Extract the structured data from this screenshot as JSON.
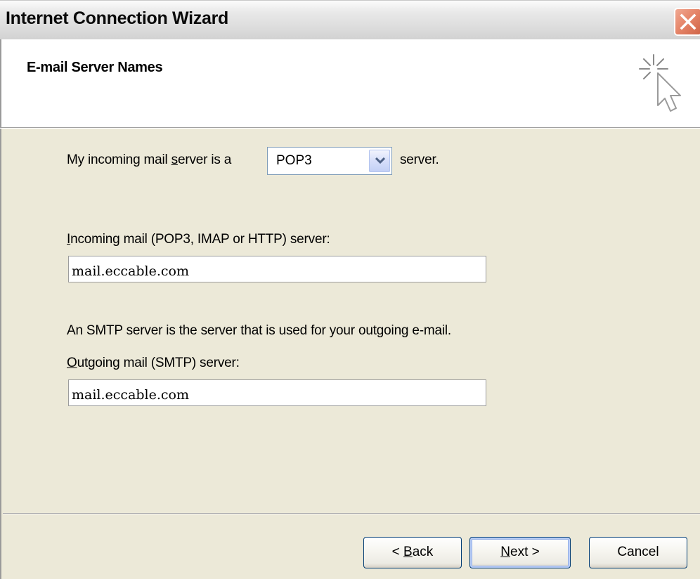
{
  "window": {
    "title": "Internet Connection Wizard",
    "close_icon": "close-x-icon"
  },
  "header": {
    "title": "E-mail Server Names",
    "icon": "wizard-cursor-sparkle-icon"
  },
  "form": {
    "incoming_type_prefix": "My incoming mail ",
    "incoming_type_accel": "s",
    "incoming_type_rest": "erver is a",
    "server_type_value": "POP3",
    "server_type_suffix": "server.",
    "incoming_label_accel": "I",
    "incoming_label_rest": "ncoming mail (POP3, IMAP or HTTP) server:",
    "incoming_value": "mail.eccable.com",
    "smtp_explanation": "An SMTP server is the server that is used for your outgoing e-mail.",
    "outgoing_label_accel": "O",
    "outgoing_label_rest": "utgoing mail (SMTP) server:",
    "outgoing_value": "mail.eccable.com"
  },
  "buttons": {
    "back_prefix": "< ",
    "back_accel": "B",
    "back_rest": "ack",
    "next_accel": "N",
    "next_rest": "ext >",
    "cancel": "Cancel"
  }
}
